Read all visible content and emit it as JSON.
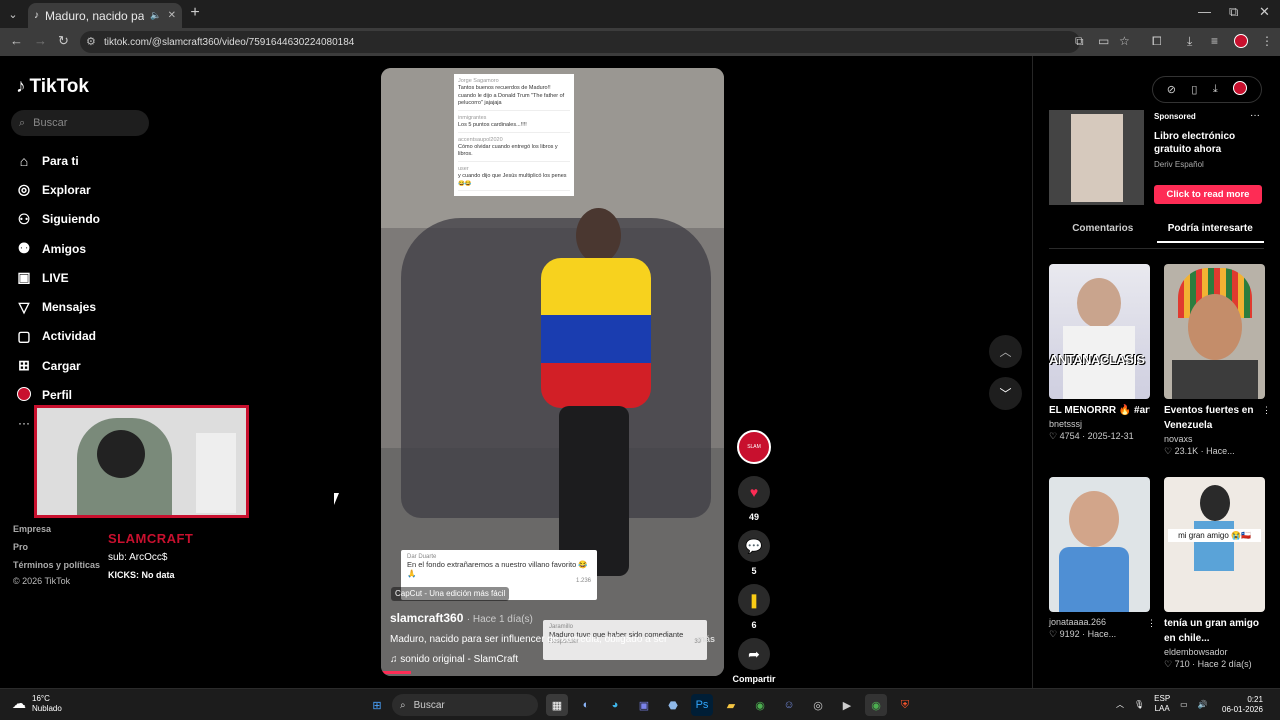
{
  "browser": {
    "tab_title": "Maduro, nacido para ser inf",
    "url": "tiktok.com/@slamcraft360/video/7591644630224080184",
    "win_min": "—",
    "win_max": "⧉",
    "win_close": "✕"
  },
  "sidebar": {
    "logo": "TikTok",
    "search_placeholder": "Buscar",
    "nav": [
      {
        "label": "Para ti",
        "icon": "home-icon"
      },
      {
        "label": "Explorar",
        "icon": "compass-icon"
      },
      {
        "label": "Siguiendo",
        "icon": "user-icon"
      },
      {
        "label": "Amigos",
        "icon": "friends-icon"
      },
      {
        "label": "LIVE",
        "icon": "live-icon"
      },
      {
        "label": "Mensajes",
        "icon": "send-icon"
      },
      {
        "label": "Actividad",
        "icon": "activity-icon"
      },
      {
        "label": "Cargar",
        "icon": "upload-icon"
      },
      {
        "label": "Perfil",
        "icon": "profile-avatar"
      }
    ],
    "more": "···",
    "footer": [
      "Empresa",
      "Pro",
      "Términos y políticas",
      "© 2026 TikTok"
    ]
  },
  "overlay": {
    "streamer_name": "SLAMCRAFT",
    "sub_text": "sub: ArcOcc$",
    "kicks": "KICKS: No data"
  },
  "video": {
    "author": "slamcraft360",
    "time": "· Hace 1 día(s)",
    "description": "Maduro, nacido para ser influencer de comedia, obligado a ser",
    "more": "más",
    "music": "♫ sonido original - SlamCraft",
    "capcut": "CapCut - Una edición más fácil",
    "comment_card_top": [
      {
        "name": "Jorge Sagamoro",
        "text": "Tantos buenos recuerdos de Maduro!! cuando le dijo a Donald Trum \"The father of pelucorro\" jajajaja"
      },
      {
        "name": "inmigrantes",
        "text": "Los 5 puntos cardinales...!!!!"
      },
      {
        "name": "accentsaupol2020",
        "text": "Cómo olvidar cuando entregó los libros y libros."
      },
      {
        "name": "user",
        "text": "y cuando dijo que Jesús multiplicó los penes 😂😂"
      }
    ],
    "comment_card_mid": {
      "name": "Dar Duarte",
      "text": "En el fondo extrañaremos a nuestro villano favorito 😂🙏",
      "likes": "1.236"
    },
    "comment_card_low": {
      "name": "Jaramillo",
      "text": "Maduro tuvo que haber sido comediante",
      "likes": "39"
    },
    "reply": "Responder"
  },
  "actions": {
    "likes": "49",
    "comments": "5",
    "saves": "6",
    "share": "Compartir"
  },
  "right": {
    "sponsored": "Sponsored",
    "ad_title": "Libro electrónico gratuito ahora",
    "ad_brand": "Deriv Español",
    "ad_button": "Click to read more",
    "tabs": [
      "Comentarios",
      "Podría interesarte"
    ],
    "cards": [
      {
        "title": "EL MENORRR 🔥 #arte #freestyle...",
        "author": "bnetsssj",
        "meta": "♡ 4754 · 2025-12-31",
        "thumb_text": "ANTANACLASIS"
      },
      {
        "title": "Eventos fuertes en Venezuela",
        "author": "novaxs",
        "meta": "♡ 23.1K · Hace...",
        "thumb_text": ""
      },
      {
        "title": "",
        "author": "jonataaaa.266",
        "meta": "♡ 9192 · Hace...",
        "thumb_text": ""
      },
      {
        "title": "tenía un gran amigo en chile...",
        "author": "eldembowsador",
        "meta": "♡ 710 · Hace 2 día(s)",
        "thumb_text": "mi gran amigo 😭🇨🇱"
      }
    ]
  },
  "taskbar": {
    "temp": "16°C",
    "weather": "Nublado",
    "search": "Buscar",
    "lang1": "ESP",
    "lang2": "LAA",
    "time": "0:21",
    "date": "06-01-2026"
  }
}
